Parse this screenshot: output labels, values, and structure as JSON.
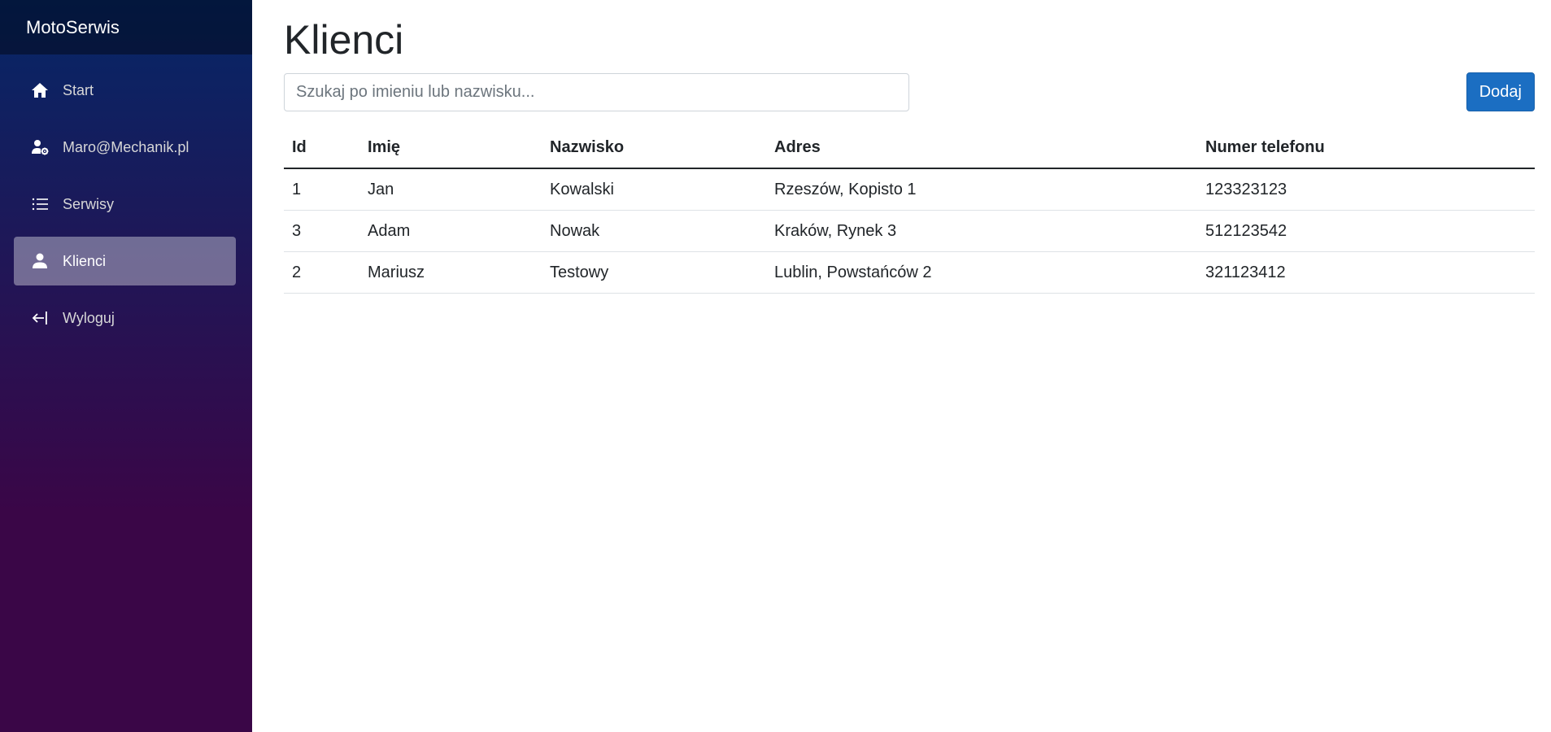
{
  "app": {
    "brand": "MotoSerwis"
  },
  "sidebar": {
    "items": [
      {
        "label": "Start",
        "icon": "home-icon",
        "active": false
      },
      {
        "label": "Maro@Mechanik.pl",
        "icon": "user-gear-icon",
        "active": false
      },
      {
        "label": "Serwisy",
        "icon": "list-icon",
        "active": false
      },
      {
        "label": "Klienci",
        "icon": "person-icon",
        "active": true
      },
      {
        "label": "Wyloguj",
        "icon": "logout-arrow-icon",
        "active": false
      }
    ]
  },
  "main": {
    "title": "Klienci",
    "search": {
      "placeholder": "Szukaj po imieniu lub nazwisku...",
      "value": ""
    },
    "add_label": "Dodaj",
    "table": {
      "headers": {
        "id": "Id",
        "imie": "Imię",
        "nazwisko": "Nazwisko",
        "adres": "Adres",
        "telefon": "Numer telefonu"
      },
      "rows": [
        {
          "id": "1",
          "imie": "Jan",
          "nazwisko": "Kowalski",
          "adres": "Rzeszów, Kopisto 1",
          "telefon": "123323123"
        },
        {
          "id": "3",
          "imie": "Adam",
          "nazwisko": "Nowak",
          "adres": "Kraków, Rynek 3",
          "telefon": "512123542"
        },
        {
          "id": "2",
          "imie": "Mariusz",
          "nazwisko": "Testowy",
          "adres": "Lublin, Powstańców 2",
          "telefon": "321123412"
        }
      ]
    }
  },
  "colors": {
    "accent": "#1b6ec2",
    "sidebar_top": "#052767",
    "sidebar_bottom": "#3a0647"
  }
}
